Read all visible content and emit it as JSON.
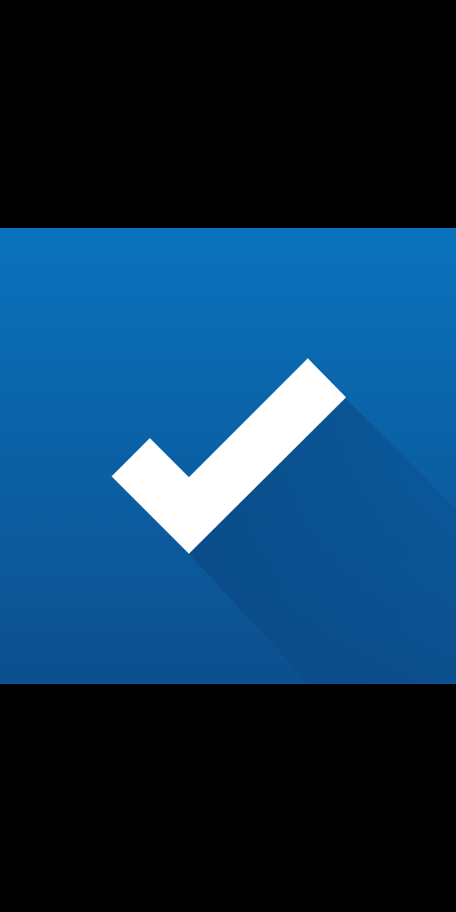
{
  "splash": {
    "icon": "checkmark-icon",
    "colors": {
      "background": "#000000",
      "panel_top": "#0a72bc",
      "panel_bottom": "#0c4f8e",
      "checkmark": "#ffffff",
      "long_shadow": "#0a3f78"
    }
  }
}
